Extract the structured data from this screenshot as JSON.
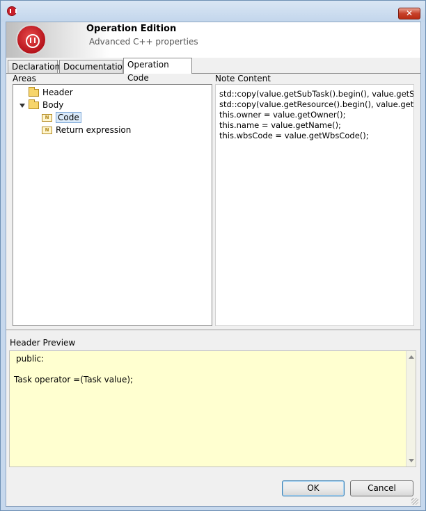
{
  "window": {
    "close_label": "✕"
  },
  "banner": {
    "title": "Operation Edition",
    "subtitle": "Advanced C++ properties"
  },
  "tabs": [
    {
      "label": "Declaration",
      "active": false
    },
    {
      "label": "Documentation",
      "active": false
    },
    {
      "label": "Operation Code",
      "active": true
    }
  ],
  "areas": {
    "label": "Areas",
    "items": [
      {
        "label": "Header",
        "icon": "folder-icon"
      },
      {
        "label": "Body",
        "icon": "folder-icon",
        "expanded": true
      },
      {
        "label": "Code",
        "icon": "note-icon",
        "selected": true
      },
      {
        "label": "Return expression",
        "icon": "note-icon"
      }
    ]
  },
  "note": {
    "label": "Note Content",
    "lines": [
      "std::copy(value.getSubTask().begin(), value.getSubT",
      "std::copy(value.getResource().begin(), value.getResc",
      "this.owner = value.getOwner();",
      "this.name = value.getName();",
      "this.wbsCode = value.getWbsCode();"
    ]
  },
  "preview": {
    "label": "Header Preview",
    "lines": [
      "public:",
      "",
      "Task operator =(Task value);"
    ]
  },
  "buttons": {
    "ok": "OK",
    "cancel": "Cancel"
  },
  "colors": {
    "preview_background": "#ffffd0",
    "brand_red": "#c8202a",
    "selection": "#dbeaf9"
  }
}
